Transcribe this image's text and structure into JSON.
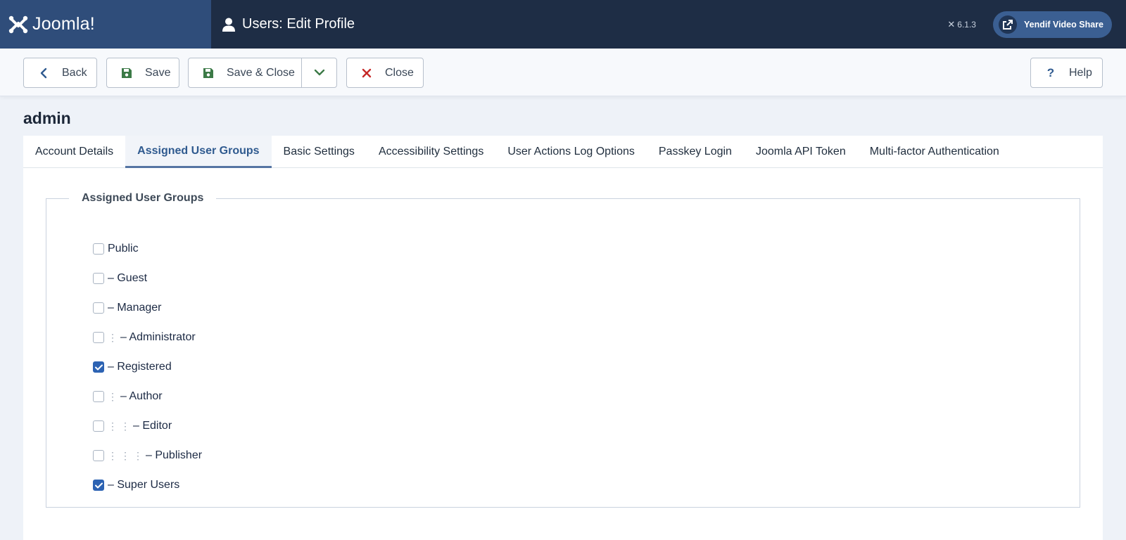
{
  "header": {
    "brand": "Joomla!",
    "page_title": "Users: Edit Profile",
    "version": "6.1.3",
    "site_button": "Yendif Video Share",
    "colors": {
      "header_bg": "#1e2d45",
      "logo_bg": "#2f4d7a",
      "site_button_bg": "#3b5f92"
    }
  },
  "toolbar": {
    "back": "Back",
    "save": "Save",
    "save_close": "Save & Close",
    "close": "Close",
    "help": "Help"
  },
  "title": "admin",
  "tabs": [
    "Account Details",
    "Assigned User Groups",
    "Basic Settings",
    "Accessibility Settings",
    "User Actions Log Options",
    "Passkey Login",
    "Joomla API Token",
    "Multi-factor Authentication"
  ],
  "active_tab": "Assigned User Groups",
  "fieldset": {
    "legend": "Assigned User Groups",
    "groups": [
      {
        "label": "Public",
        "checked": false
      },
      {
        "label": "– Guest",
        "checked": false
      },
      {
        "label": "– Manager",
        "checked": false
      },
      {
        "label": "– Administrator",
        "checked": false
      },
      {
        "label": "– Registered",
        "checked": true
      },
      {
        "label": "– Author",
        "checked": false
      },
      {
        "label": "– Editor",
        "checked": false
      },
      {
        "label": "– Publisher",
        "checked": false
      },
      {
        "label": "– Super Users",
        "checked": true
      }
    ]
  },
  "icons": {
    "back": "chevron-left-icon",
    "save": "floppy-icon",
    "close": "x-icon",
    "help": "question-icon",
    "dropdown": "chevron-down-icon",
    "site": "external-link-icon"
  },
  "accent": "#2d63b3"
}
